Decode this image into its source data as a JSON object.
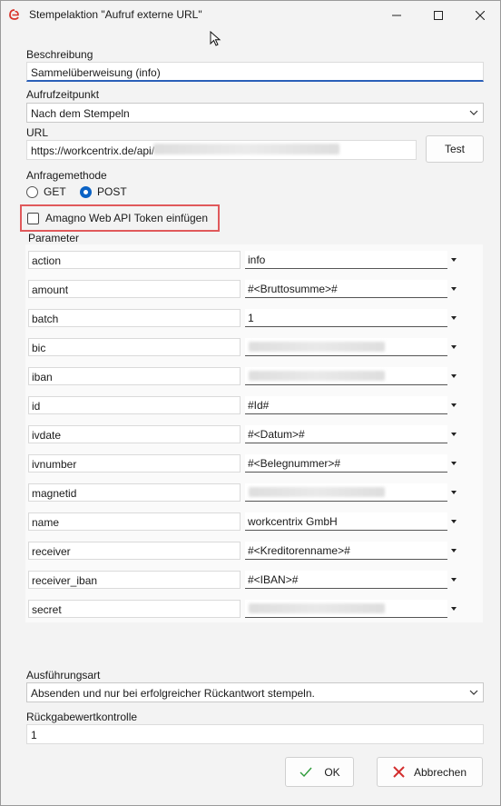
{
  "window": {
    "title": "Stempelaktion \"Aufruf externe URL\"",
    "controls": {
      "minimize": "minimize-icon",
      "maximize": "maximize-icon",
      "close": "close-icon"
    }
  },
  "form": {
    "beschreibung_label": "Beschreibung",
    "beschreibung_value": "Sammelüberweisung (info)",
    "aufrufzeitpunkt_label": "Aufrufzeitpunkt",
    "aufrufzeitpunkt_value": "Nach dem Stempeln",
    "url_label": "URL",
    "url_value": "https://workcentrix.de/api/",
    "test_label": "Test",
    "anfragemethode_label": "Anfragemethode",
    "method_get": "GET",
    "method_post": "POST",
    "selected_method": "POST",
    "token_label": "Amagno Web API Token einfügen",
    "token_checked": false,
    "parameter_label": "Parameter",
    "parameters": [
      {
        "name": "action",
        "value": "info",
        "blurred": false
      },
      {
        "name": "amount",
        "value": "#<Bruttosumme>#",
        "blurred": false
      },
      {
        "name": "batch",
        "value": "1",
        "blurred": false
      },
      {
        "name": "bic",
        "value": "",
        "blurred": true
      },
      {
        "name": "iban",
        "value": "",
        "blurred": true
      },
      {
        "name": "id",
        "value": "#Id#",
        "blurred": false
      },
      {
        "name": "ivdate",
        "value": "#<Datum>#",
        "blurred": false
      },
      {
        "name": "ivnumber",
        "value": "#<Belegnummer>#",
        "blurred": false
      },
      {
        "name": "magnetid",
        "value": "",
        "blurred": true
      },
      {
        "name": "name",
        "value": "workcentrix GmbH",
        "blurred": false
      },
      {
        "name": "receiver",
        "value": "#<Kreditorenname>#",
        "blurred": false
      },
      {
        "name": "receiver_iban",
        "value": "#<IBAN>#",
        "blurred": false
      },
      {
        "name": "secret",
        "value": "",
        "blurred": true
      }
    ],
    "ausfuehrungsart_label": "Ausführungsart",
    "ausfuehrungsart_value": "Absenden und nur bei erfolgreicher Rückantwort stempeln.",
    "rueckgabe_label": "Rückgabewertkontrolle",
    "rueckgabe_value": "1",
    "ok_label": "OK",
    "cancel_label": "Abbrechen"
  },
  "colors": {
    "accent": "#0b63c5",
    "highlight_border": "#e0595b",
    "ok_check": "#2e9b3a",
    "cancel_x": "#d32f2f"
  }
}
